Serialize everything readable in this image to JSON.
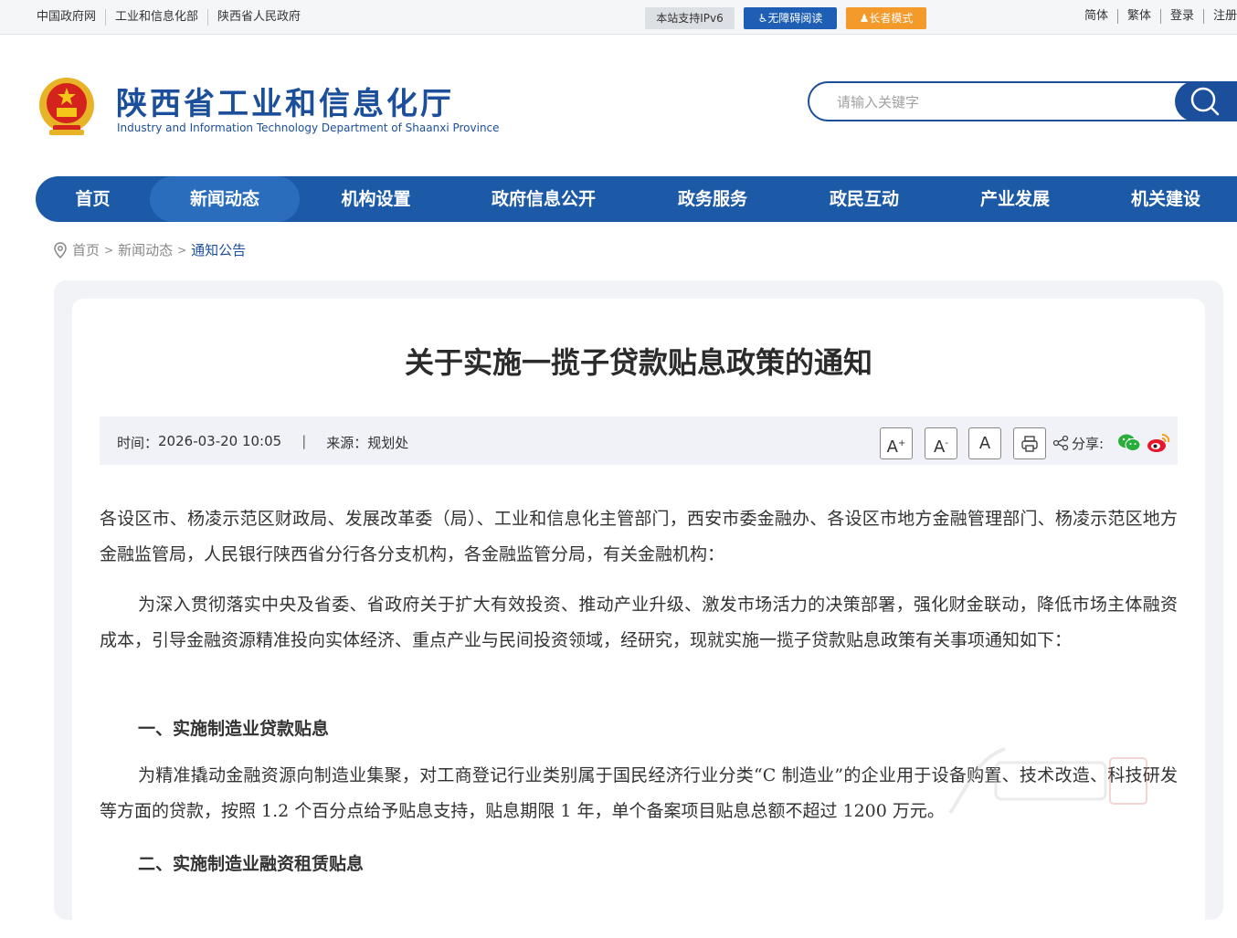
{
  "topbar": {
    "links": [
      "中国政府网",
      "工业和信息化部",
      "陕西省人民政府"
    ],
    "ipv6": "本站支持IPv6",
    "accessible": "无障碍阅读",
    "elder": "长者模式",
    "right_links": [
      "简体",
      "繁体",
      "登录",
      "注册"
    ]
  },
  "header": {
    "title": "陕西省工业和信息化厅",
    "subtitle": "Industry and Information Technology Department of Shaanxi Province"
  },
  "search": {
    "placeholder": "请输入关键字"
  },
  "nav": {
    "items": [
      "首页",
      "新闻动态",
      "机构设置",
      "政府信息公开",
      "政务服务",
      "政民互动",
      "产业发展",
      "机关建设"
    ],
    "active": "新闻动态"
  },
  "breadcrumb": {
    "home": "首页",
    "sep": ">",
    "level1": "新闻动态",
    "current": "通知公告"
  },
  "article": {
    "title": "关于实施一揽子贷款贴息政策的通知",
    "time_label": "时间：",
    "time": "2026-03-20 10:05",
    "divider": "|",
    "source_label": "来源：",
    "source": "规划处",
    "font_btns": [
      "A",
      "A",
      "A"
    ],
    "share_label": "分享:",
    "para1": "各设区市、杨凌示范区财政局、发展改革委（局）、工业和信息化主管部门，西安市委金融办、各设区市地方金融管理部门、杨凌示范区地方金融监管局，人民银行陕西省分行各分支机构，各金融监管分局，有关金融机构：",
    "para2": "为深入贯彻落实中央及省委、省政府关于扩大有效投资、推动产业升级、激发市场活力的决策部署，强化财金联动，降低市场主体融资成本，引导金融资源精准投向实体经济、重点产业与民间投资领域，经研究，现就实施一揽子贷款贴息政策有关事项通知如下：",
    "h1": "一、实施制造业贷款贴息",
    "para3": "为精准撬动金融资源向制造业集聚，对工商登记行业类别属于国民经济行业分类“C 制造业”的企业用于设备购置、技术改造、科技研发等方面的贷款，按照 1.2 个百分点给予贴息支持，贴息期限 1 年，单个备案项目贴息总额不超过 1200 万元。",
    "h2": "二、实施制造业融资租赁贴息"
  },
  "colors": {
    "brand": "#1b4f9c",
    "nav": "#1c5aa8",
    "elder": "#f39a2b"
  }
}
